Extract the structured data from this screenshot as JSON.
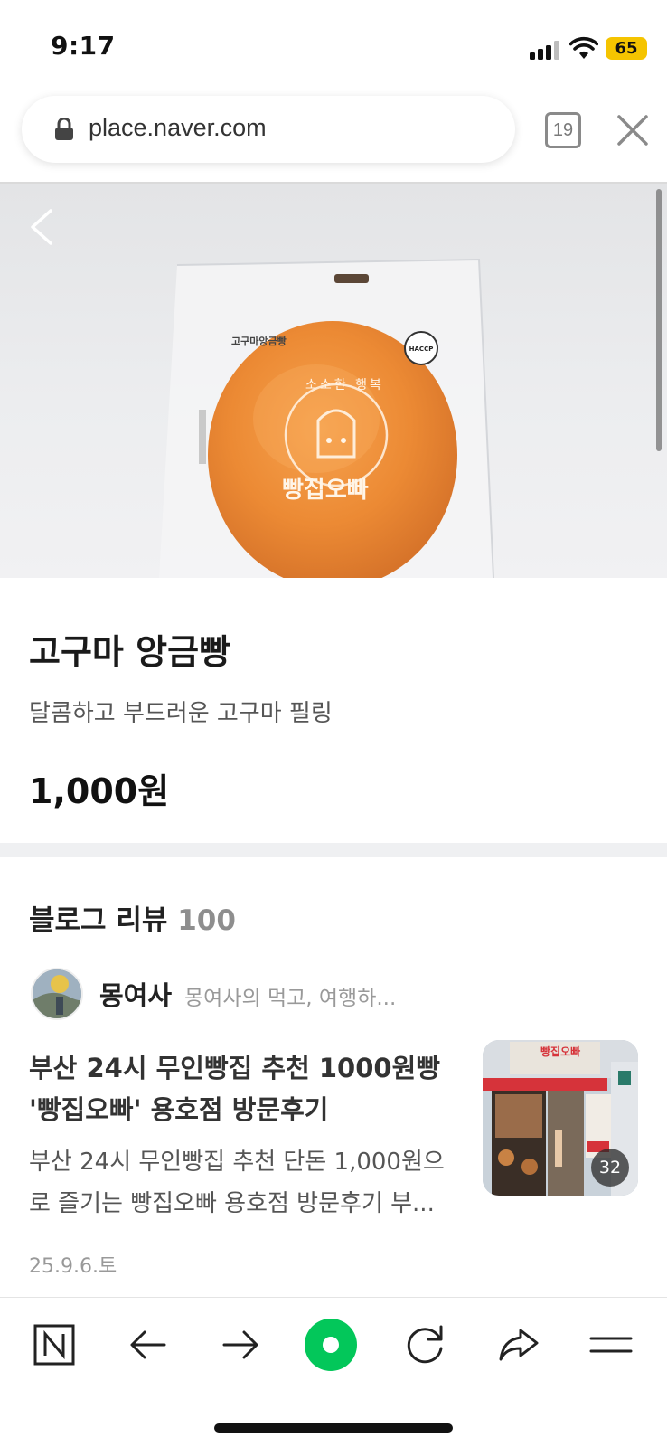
{
  "status_bar": {
    "time": "9:17",
    "battery": "65",
    "battery_color": "#f5c400"
  },
  "browser": {
    "url": "place.naver.com",
    "tab_count": "19",
    "lock_icon": "lock-icon",
    "close_icon": "close-icon"
  },
  "hero": {
    "back_icon": "chevron-left-icon",
    "package_label": "고구마앙금빵",
    "brand_arc": "소소한 행복",
    "brand_name": "빵집오빠",
    "haccp": "HACCP"
  },
  "product": {
    "name": "고구마 앙금빵",
    "description": "달콤하고 부드러운 고구마 필링",
    "price": "1,000원"
  },
  "blog": {
    "title": "블로그 리뷰",
    "count": "100",
    "review": {
      "author": "몽여사",
      "author_desc": "몽여사의 먹고, 여행하...",
      "title": "부산 24시 무인빵집 추천 1000원빵 '빵집오빠' 용호점 방문후기",
      "excerpt": "부산 24시 무인빵집 추천 단돈 1,000원으로 즐기는 빵집오빠 용호점 방문후기 부...",
      "date": "25.9.6.토",
      "photo_count": "32",
      "thumb_sign": "빵집오빠"
    }
  },
  "bottom_bar": {
    "items": [
      "naver-n-icon",
      "arrow-left-icon",
      "arrow-right-icon",
      "green-dot-icon",
      "refresh-icon",
      "share-icon",
      "menu-icon"
    ],
    "accent": "#03c75a"
  }
}
